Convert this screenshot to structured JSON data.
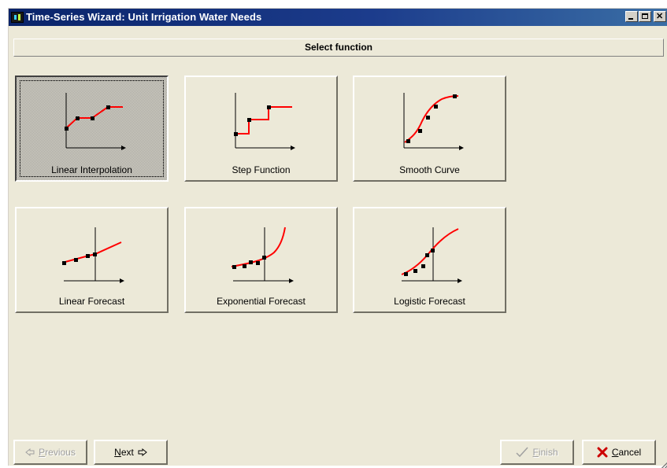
{
  "window": {
    "title": "Time-Series Wizard: Unit Irrigation Water Needs",
    "app_icon": "wizard-app-icon",
    "controls": [
      "minimize-icon",
      "maximize-icon",
      "close-icon"
    ]
  },
  "header": {
    "title": "Select function"
  },
  "functions": [
    {
      "label": "Linear Interpolation",
      "icon": "linear-interpolation-graph-icon",
      "selected": true
    },
    {
      "label": "Step Function",
      "icon": "step-function-graph-icon",
      "selected": false
    },
    {
      "label": "Smooth Curve",
      "icon": "smooth-curve-graph-icon",
      "selected": false
    },
    {
      "label": "Linear Forecast",
      "icon": "linear-forecast-graph-icon",
      "selected": false
    },
    {
      "label": "Exponential Forecast",
      "icon": "exponential-forecast-graph-icon",
      "selected": false
    },
    {
      "label": "Logistic Forecast",
      "icon": "logistic-forecast-graph-icon",
      "selected": false
    }
  ],
  "nav": {
    "previous": {
      "label": "Previous",
      "accel": "P",
      "rest": "revious",
      "enabled": false,
      "icon": "arrow-left-icon"
    },
    "next": {
      "label": "Next",
      "accel": "N",
      "rest": "ext",
      "enabled": true,
      "icon": "arrow-right-icon"
    },
    "finish": {
      "label": "Finish",
      "accel": "F",
      "rest": "inish",
      "enabled": false,
      "icon": "checkmark-icon"
    },
    "cancel": {
      "label": "Cancel",
      "accel": "C",
      "rest": "ancel",
      "enabled": true,
      "icon": "x-icon"
    }
  },
  "colors": {
    "curve": "#ff0000",
    "point": "#000000",
    "titlebar": "#0a246a"
  }
}
